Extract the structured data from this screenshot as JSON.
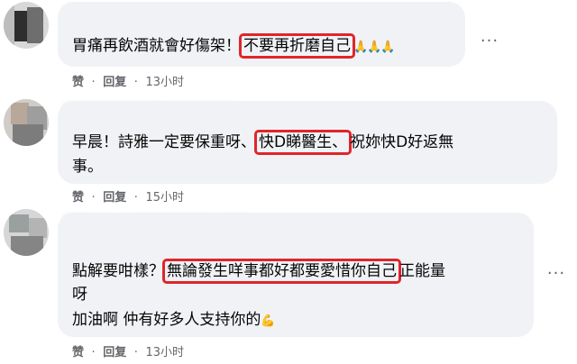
{
  "comments": [
    {
      "text_before": "胃痛再飲酒就會好傷架！",
      "highlight": "不要再折磨自己",
      "text_after": "",
      "emoji": "🙏🙏🙏",
      "like": "赞",
      "reply": "回复",
      "dot": "·",
      "time": "13小时"
    },
    {
      "text_before": "早晨！詩雅一定要保重呀、",
      "highlight": "快D睇醫生、",
      "text_after": "祝妳快D好返無",
      "line2": "事。",
      "like": "赞",
      "reply": "回复",
      "dot": "·",
      "time": "15小时"
    },
    {
      "text_before": "點解要咁樣？",
      "highlight": "無論發生咩事都好都要愛惜你自己",
      "text_after": "正能量",
      "line2": "呀",
      "line3": "加油啊 仲有好多人支持你的",
      "emoji": "💪",
      "like": "赞",
      "reply": "回复",
      "dot": "·",
      "time": "13小时"
    }
  ],
  "more_glyph": "···",
  "colors": {
    "bubble": "#f0f2f5",
    "highlight_border": "#e0252b",
    "meta": "#65676b"
  }
}
